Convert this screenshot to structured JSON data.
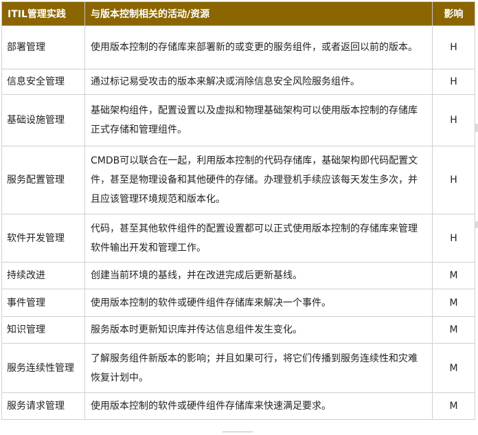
{
  "table": {
    "headers": {
      "practice": "ITIL管理实践",
      "activity": "与版本控制相关的活动/资源",
      "impact": "影响"
    },
    "rows": [
      {
        "practice": "部署管理",
        "activity": "使用版本控制的存储库来部署新的或变更的服务组件，或者返回以前的版本。",
        "impact": "H"
      },
      {
        "practice": "信息安全管理",
        "activity": "通过标记易受攻击的版本来解决或消除信息安全风险服务组件。",
        "impact": "H"
      },
      {
        "practice": "基础设施管理",
        "activity": "基础架构组件，配置设置以及虚拟和物理基础架构可以使用版本控制的存储库正式存储和管理组件。",
        "impact": "H"
      },
      {
        "practice": "服务配置管理",
        "activity": "CMDB可以联合在一起，利用版本控制的代码存储库，基础架构即代码配置文件，甚至是物理设备和其他硬件的存储。办理登机手续应该每天发生多次，并且应该管理环境规范和版本化。",
        "impact": "H"
      },
      {
        "practice": "软件开发管理",
        "activity": "代码，甚至其他软件组件的配置设置都可以正式使用版本控制的存储库来管理软件输出开发和管理工作。",
        "impact": "H"
      },
      {
        "practice": "持续改进",
        "activity": "创建当前环境的基线，并在改进完成后更新基线。",
        "impact": "M"
      },
      {
        "practice": "事件管理",
        "activity": "使用版本控制的软件或硬件组件存储库来解决一个事件。",
        "impact": "M"
      },
      {
        "practice": "知识管理",
        "activity": "服务版本时更新知识库并传达信息组件发生变化。",
        "impact": "M"
      },
      {
        "practice": "服务连续性管理",
        "activity": "了解服务组件新版本的影响；并且如果可行，将它们传播到服务连续性和灾难恢复计划中。",
        "impact": "M"
      },
      {
        "practice": "服务请求管理",
        "activity": "使用版本控制的软件或硬件组件存储库来快速满足要求。",
        "impact": "M"
      }
    ]
  },
  "colors": {
    "header_bg": "#8b6500",
    "header_text": "#ffffff",
    "border": "#cfcfcf"
  }
}
